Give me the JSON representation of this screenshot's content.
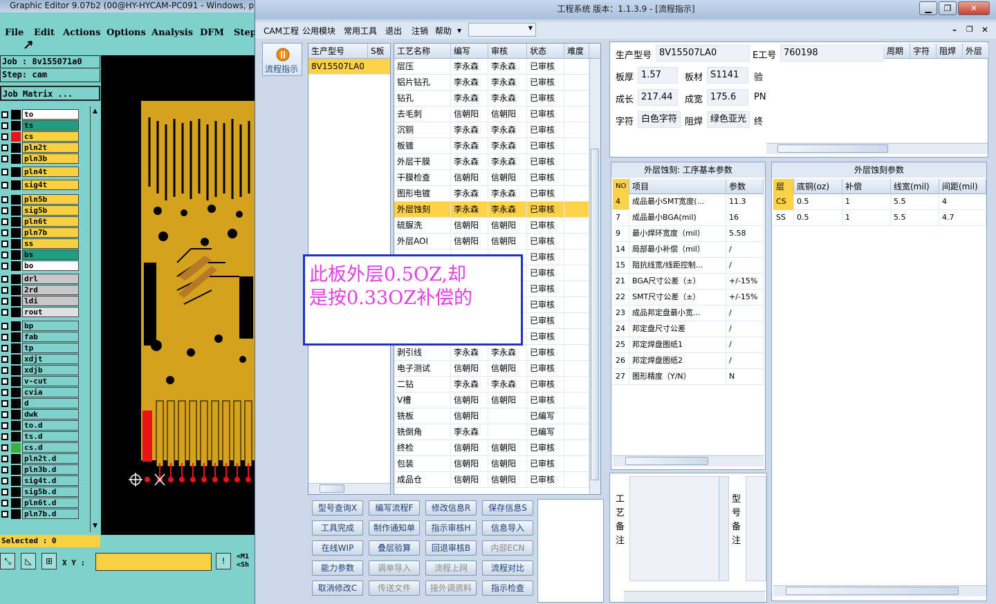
{
  "left_app": {
    "title": "Graphic Editor 9.07b2 (00@HY-HYCAM-PC091 - Windows, pi",
    "menu": [
      "File",
      "Edit",
      "Actions",
      "Options",
      "Analysis",
      "DFM",
      "Step"
    ],
    "job": "Job : 8v155071a0",
    "step": "Step: cam",
    "job_matrix": "Job Matrix ...",
    "layers": [
      {
        "name": "to",
        "color": "#ffffff"
      },
      {
        "name": "ts",
        "color": "#1f9e80"
      },
      {
        "name": "cs",
        "color": "#f8d040"
      },
      {
        "name": "pln2t",
        "color": "#f8d040"
      },
      {
        "name": "pln3b",
        "color": "#f8d040"
      },
      {
        "name": "pln4t",
        "color": "#f8d040"
      },
      {
        "name": "sig4t",
        "color": "#f8d040"
      },
      {
        "name": "pln5b",
        "color": "#f8d040"
      },
      {
        "name": "sig5b",
        "color": "#f8d040"
      },
      {
        "name": "pln6t",
        "color": "#f8d040"
      },
      {
        "name": "pln7b",
        "color": "#f8d040"
      },
      {
        "name": "ss",
        "color": "#f8d040"
      },
      {
        "name": "bs",
        "color": "#1f9e80"
      },
      {
        "name": "bo",
        "color": "#ffffff"
      },
      {
        "name": "drl",
        "color": "#c8c8c8"
      },
      {
        "name": "2rd",
        "color": "#c8c8c8"
      },
      {
        "name": "ldi",
        "color": "#c8c8c8"
      },
      {
        "name": "rout",
        "color": "#e0e0e0"
      },
      {
        "name": "bp",
        "color": "#7fd1cc"
      },
      {
        "name": "fab",
        "color": "#7fd1cc"
      },
      {
        "name": "tp",
        "color": "#7fd1cc"
      },
      {
        "name": "xdjt",
        "color": "#7fd1cc"
      },
      {
        "name": "xdjb",
        "color": "#7fd1cc"
      },
      {
        "name": "v-cut",
        "color": "#7fd1cc"
      },
      {
        "name": "cvia",
        "color": "#7fd1cc"
      },
      {
        "name": "d",
        "color": "#7fd1cc"
      },
      {
        "name": "dwk",
        "color": "#7fd1cc"
      },
      {
        "name": "to.d",
        "color": "#7fd1cc"
      },
      {
        "name": "ts.d",
        "color": "#7fd1cc"
      },
      {
        "name": "cs.d",
        "color": "#7fd1cc"
      },
      {
        "name": "pln2t.d",
        "color": "#7fd1cc"
      },
      {
        "name": "pln3b.d",
        "color": "#7fd1cc"
      },
      {
        "name": "sig4t.d",
        "color": "#7fd1cc"
      },
      {
        "name": "sig5b.d",
        "color": "#7fd1cc"
      },
      {
        "name": "pln6t.d",
        "color": "#7fd1cc"
      },
      {
        "name": "pln7b.d",
        "color": "#7fd1cc"
      }
    ],
    "selected": "Selected : 0",
    "xy_label": "X Y :",
    "side_text_1": "<M1",
    "side_text_2": "<Sh"
  },
  "erp": {
    "title": "工程系统   版本：1.1.3.9 - [流程指示]",
    "menu": [
      "CAM工程",
      "公用模块",
      "常用工具",
      "退出",
      "注销",
      "帮助"
    ],
    "side_button": "流程指示",
    "model_grid": {
      "headers": [
        "生产型号",
        "S板"
      ],
      "rows": [
        [
          "8V15507LA0",
          ""
        ]
      ]
    },
    "process_grid": {
      "headers": [
        "工艺名称",
        "编写",
        "审核",
        "状态",
        "难度"
      ],
      "rows": [
        [
          "层压",
          "李永森",
          "李永森",
          "已审核",
          ""
        ],
        [
          "铝片钻孔",
          "李永森",
          "李永森",
          "已审核",
          ""
        ],
        [
          "钻孔",
          "李永森",
          "李永森",
          "已审核",
          ""
        ],
        [
          "去毛刺",
          "信朝阳",
          "信朝阳",
          "已审核",
          ""
        ],
        [
          "沉铜",
          "李永森",
          "李永森",
          "已审核",
          ""
        ],
        [
          "板镀",
          "李永森",
          "李永森",
          "已审核",
          ""
        ],
        [
          "外层干膜",
          "李永森",
          "李永森",
          "已审核",
          ""
        ],
        [
          "干膜检查",
          "信朝阳",
          "信朝阳",
          "已审核",
          ""
        ],
        [
          "图形电镀",
          "李永森",
          "李永森",
          "已审核",
          ""
        ],
        [
          "外层蚀刻",
          "李永森",
          "李永森",
          "已审核",
          ""
        ],
        [
          "硫脲洗",
          "信朝阳",
          "信朝阳",
          "已审核",
          ""
        ],
        [
          "外层AOI",
          "信朝阳",
          "信朝阳",
          "已审核",
          ""
        ],
        [
          "",
          "",
          "",
          "已审核",
          ""
        ],
        [
          "",
          "",
          "",
          "已审核",
          ""
        ],
        [
          "",
          "",
          "",
          "已审核",
          ""
        ],
        [
          "",
          "",
          "",
          "已审核",
          ""
        ],
        [
          "",
          "",
          "",
          "已审核",
          ""
        ],
        [
          "",
          "",
          "",
          "已审核",
          ""
        ],
        [
          "剥引线",
          "李永森",
          "李永森",
          "已审核",
          ""
        ],
        [
          "电子测试",
          "信朝阳",
          "信朝阳",
          "已审核",
          ""
        ],
        [
          "二钻",
          "李永森",
          "李永森",
          "已审核",
          ""
        ],
        [
          "V槽",
          "信朝阳",
          "信朝阳",
          "已审核",
          ""
        ],
        [
          "铣板",
          "信朝阳",
          "",
          "已编写",
          ""
        ],
        [
          "铣倒角",
          "李永森",
          "",
          "已编写",
          ""
        ],
        [
          "终检",
          "信朝阳",
          "信朝阳",
          "已审核",
          ""
        ],
        [
          "包装",
          "信朝阳",
          "信朝阳",
          "已审核",
          ""
        ],
        [
          "成品仓",
          "信朝阳",
          "信朝阳",
          "已审核",
          ""
        ]
      ],
      "highlight_row": 9
    },
    "info": {
      "model_label": "生产型号",
      "model_value": "8V15507LA0",
      "eng_label": "E工号",
      "eng_value": "760198",
      "cols": [
        "周期",
        "字符",
        "阻焊",
        "外层"
      ],
      "thick_label": "板厚",
      "thick_value": "1.57",
      "material_label": "板材",
      "material_value": "S1141",
      "check_label": "验",
      "len_label": "成长",
      "len_value": "217.44",
      "width_label": "成宽",
      "width_value": "175.6",
      "pn_label": "PN",
      "char_label": "字符",
      "char_value": "白色字符",
      "mask_label": "阻焊",
      "mask_value": "绿色亚光",
      "end_label": "终"
    },
    "params_panel": {
      "title": "外层蚀刻: 工序基本参数",
      "headers": [
        "NO",
        "项目",
        "参数"
      ],
      "rows": [
        [
          "4",
          "成品最小SMT宽度(...",
          "11.3"
        ],
        [
          "7",
          "成品最小BGA(mil)",
          "16"
        ],
        [
          "9",
          "最小焊环宽度（mil）",
          "5.58"
        ],
        [
          "14",
          "局部最小补偿（mil）",
          "/"
        ],
        [
          "15",
          "阻抗线宽/线距控制...",
          "/"
        ],
        [
          "21",
          "BGA尺寸公差（±）",
          "+/-15%"
        ],
        [
          "22",
          "SMT尺寸公差（±）",
          "+/-15%"
        ],
        [
          "23",
          "成品邦定盘最小宽...",
          "/"
        ],
        [
          "24",
          "邦定盘尺寸公差",
          "/"
        ],
        [
          "25",
          "邦定焊盘图纸1",
          "/"
        ],
        [
          "26",
          "邦定焊盘图纸2",
          "/"
        ],
        [
          "27",
          "图形精度（Y/N）",
          "N"
        ]
      ]
    },
    "etch_panel": {
      "title": "外层蚀刻参数",
      "headers": [
        "层",
        "底铜(oz)",
        "补偿",
        "线宽(mil)",
        "间距(mil)"
      ],
      "rows": [
        [
          "CS",
          "0.5",
          "1",
          "5.5",
          "4"
        ],
        [
          "SS",
          "0.5",
          "1",
          "5.5",
          "4.7"
        ]
      ]
    },
    "notes": {
      "process_label": "工艺备注",
      "model_label": "型号备注"
    },
    "buttons": [
      [
        "型号查询X",
        "编写流程F",
        "修改信息R",
        "保存信息S"
      ],
      [
        "工具完成",
        "制作通知单",
        "指示审核H",
        "信息导入"
      ],
      [
        "在线WIP",
        "叠层验算",
        "回退审核B",
        "内部ECN"
      ],
      [
        "能力参数",
        "调单导入",
        "流程上网",
        "流程对比"
      ],
      [
        "取消修改C",
        "传送文件",
        "接外调资料",
        "指示检查"
      ]
    ],
    "disabled_buttons": [
      "内部ECN",
      "调单导入",
      "流程上网",
      "传送文件",
      "接外调资料"
    ]
  },
  "annotation": {
    "line1": "此板外层0.5OZ,却",
    "line2": "是按0.33OZ补偿的"
  },
  "colors": {
    "highlight": "#ffd24a",
    "pcb_copper": "#d4a21c",
    "annotation_text": "#e040e0",
    "annotation_border": "#2030c8"
  }
}
